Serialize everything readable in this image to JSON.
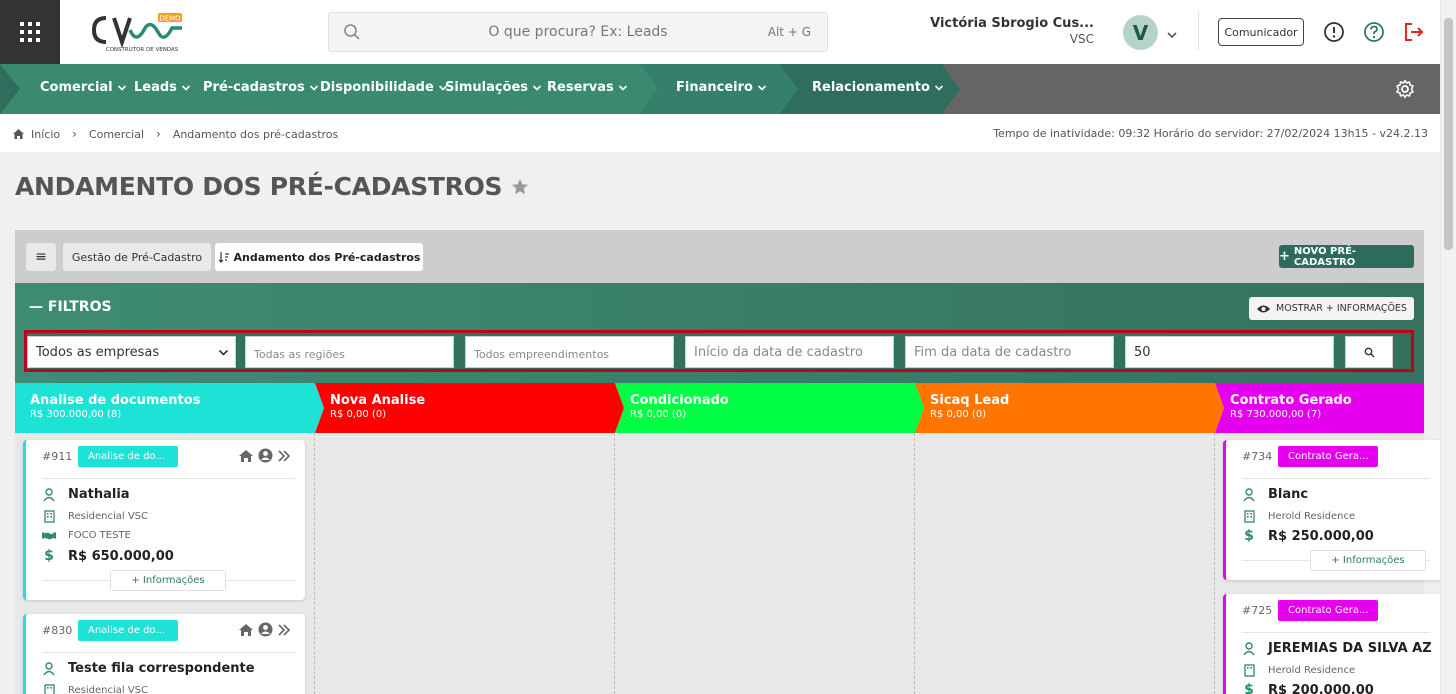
{
  "header": {
    "logo_text": "CV",
    "logo_badge": "DEMO",
    "logo_tagline": "CONSTRUTOR DE VENDAS",
    "search_placeholder": "O que procura? Ex: Leads",
    "search_shortcut": "Alt + G",
    "user_name": "Victória Sbrogio Cus...",
    "user_company": "VSC",
    "avatar_letter": "V",
    "communicator_label": "Comunicador"
  },
  "nav": {
    "items": [
      {
        "label": "Comercial",
        "icon": "chevron-down-icon"
      },
      {
        "label": "Leads",
        "icon": "chevron-down-icon"
      },
      {
        "label": "Pré-cadastros",
        "icon": "chevron-down-icon"
      },
      {
        "label": "Disponibilidade",
        "icon": "chevron-down-icon"
      },
      {
        "label": "Simulações",
        "icon": "chevron-down-icon"
      },
      {
        "label": "Reservas",
        "icon": "chevron-down-icon"
      },
      {
        "label": "Financeiro",
        "icon": "chevron-down-icon"
      },
      {
        "label": "Relacionamento",
        "icon": "chevron-down-icon"
      }
    ],
    "colors": {
      "dark": "#2f6e5c",
      "mid": "#3a8a70",
      "gray": "#666666"
    }
  },
  "breadcrumb": {
    "items": [
      "Início",
      "Comercial",
      "Andamento dos pré-cadastros"
    ],
    "server_info": "Tempo de inatividade: 09:32  Horário do servidor: 27/02/2024 13h15 - v24.2.13"
  },
  "page": {
    "title": "ANDAMENTO DOS PRÉ-CADASTROS"
  },
  "tabs": {
    "menu_icon": "≡",
    "tab1": "Gestão de Pré-Cadastro",
    "tab2": "Andamento dos Pré-cadastros",
    "new_button": "NOVO PRÉ-CADASTRO"
  },
  "filters": {
    "title": "FILTROS",
    "show_more": "MOSTRAR + INFORMAÇÕES",
    "company_select": "Todos as empresas",
    "regions_placeholder": "Todas as regiões",
    "developments_placeholder": "Todos empreendimentos",
    "date_start_placeholder": "Início da data de cadastro",
    "date_end_placeholder": "Fim da data de cadastro",
    "limit_value": "50",
    "accent_color": "#c1001c"
  },
  "columns": [
    {
      "title": "Analise de documentos",
      "summary": "R$ 300.000,00 (8)",
      "color": "#1de3d6"
    },
    {
      "title": "Nova Analise",
      "summary": "R$ 0,00 (0)",
      "color": "#fe0000"
    },
    {
      "title": "Condicionado",
      "summary": "R$ 0,00 (0)",
      "color": "#00ff44"
    },
    {
      "title": "Sicaq Lead",
      "summary": "R$ 0,00 (0)",
      "color": "#ff7500"
    },
    {
      "title": "Contrato Gerado",
      "summary": "R$ 730.000,00 (7)",
      "color": "#e500ef"
    }
  ],
  "cards": [
    {
      "number": "#911",
      "badge": "Analise de do...",
      "name": "Nathalia",
      "development": "Residencial VSC",
      "extra": "FOCO TESTE",
      "price": "R$ 650.000,00",
      "info": "+ Informações"
    },
    {
      "number": "#830",
      "badge": "Analise de do...",
      "name": "Teste fila correspondente",
      "development": "Residencial VSC"
    },
    {
      "number": "#734",
      "badge": "Contrato Gera...",
      "name": "Blanc",
      "development": "Herold Residence",
      "price": "R$ 250.000,00",
      "info": "+ Informações"
    },
    {
      "number": "#725",
      "badge": "Contrato Gera...",
      "name": "JEREMIAS DA SILVA AZ",
      "development": "Herold Residence",
      "price": "R$ 200.000,00"
    }
  ]
}
